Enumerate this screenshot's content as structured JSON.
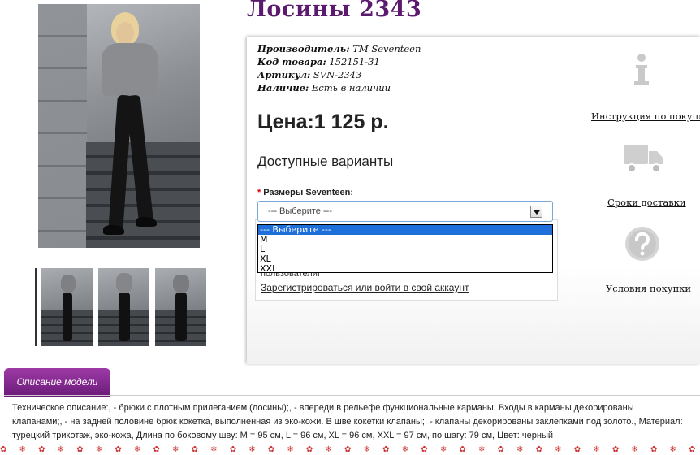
{
  "product": {
    "title": "Лосины 2343",
    "manufacturer_label": "Производитель:",
    "manufacturer_value": "ТМ Seventeen",
    "code_label": "Код товара:",
    "code_value": "152151-31",
    "sku_label": "Артикул:",
    "sku_value": "SVN-2343",
    "stock_label": "Наличие:",
    "stock_value": "Есть в наличии",
    "price": "Цена:1 125 р."
  },
  "options": {
    "heading": "Доступные варианты",
    "required_mark": "*",
    "size_label": "Размеры Seventeen:",
    "select_value": "--- Выберите ---",
    "dropdown_items": [
      "--- Выберите ---",
      "M",
      "L",
      "XL",
      "XXL"
    ]
  },
  "login": {
    "text_partial": "пользователи!",
    "link": "Зарегистрироваться или войти в свой аккаунт"
  },
  "sidebar": {
    "instruction_link": "Инструкция по покупке",
    "delivery_link": "Сроки доставки",
    "terms_link": "Условия покупки",
    "icons": [
      "info-icon",
      "truck-icon",
      "question-icon"
    ]
  },
  "tabs": {
    "description_tab": "Описание модели"
  },
  "description": "Техническое описание:, - брюки с плотным прилеганием (лосины);, - впереди в рельефе функциональные карманы. Входы в карманы декорированы клапанами;, - на задней половине брюк кокетка, выполненная из эко-кожи. В шве кокетки клапаны;, - клапаны декорированы заклепками под золото., Материал: турецкий трикотаж, эко-кожа, Длина по боковому шву: M = 95 см, L = 96 см, XL = 96 см, XXL = 97 см, по шагу: 79 см, Цвет: черный",
  "colors": {
    "title": "#5c1a6e",
    "tab": "#8a2b96",
    "selected_option": "#1e6fd9",
    "required": "#dd0000"
  }
}
